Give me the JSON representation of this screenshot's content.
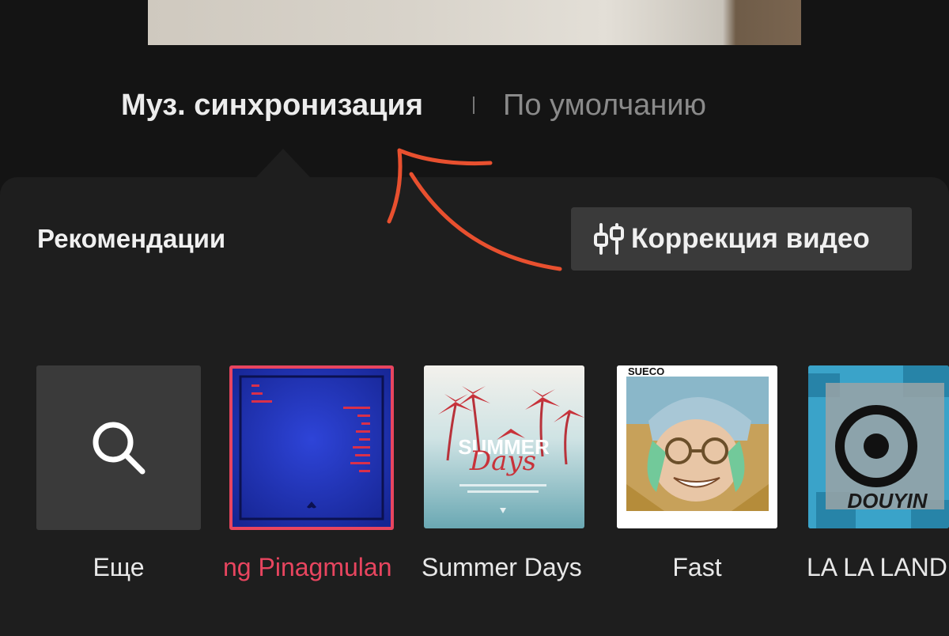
{
  "tabs": {
    "active": "Муз. синхронизация",
    "inactive": "По умолчанию"
  },
  "panel": {
    "title": "Рекомендации",
    "correction_button": "Коррекция видео"
  },
  "tracks": [
    {
      "label": "Еще",
      "icon": "search-icon"
    },
    {
      "label": "ng Pinagmulan",
      "selected": true
    },
    {
      "label": "Summer Days"
    },
    {
      "label": "Fast",
      "cover_text": "SUECO"
    },
    {
      "label": "LA LA LAND",
      "cover_text": "DOUYIN"
    }
  ],
  "colors": {
    "background": "#141414",
    "panel": "#1e1e1e",
    "selected_accent": "#e8455f",
    "annotation": "#e8502f"
  }
}
